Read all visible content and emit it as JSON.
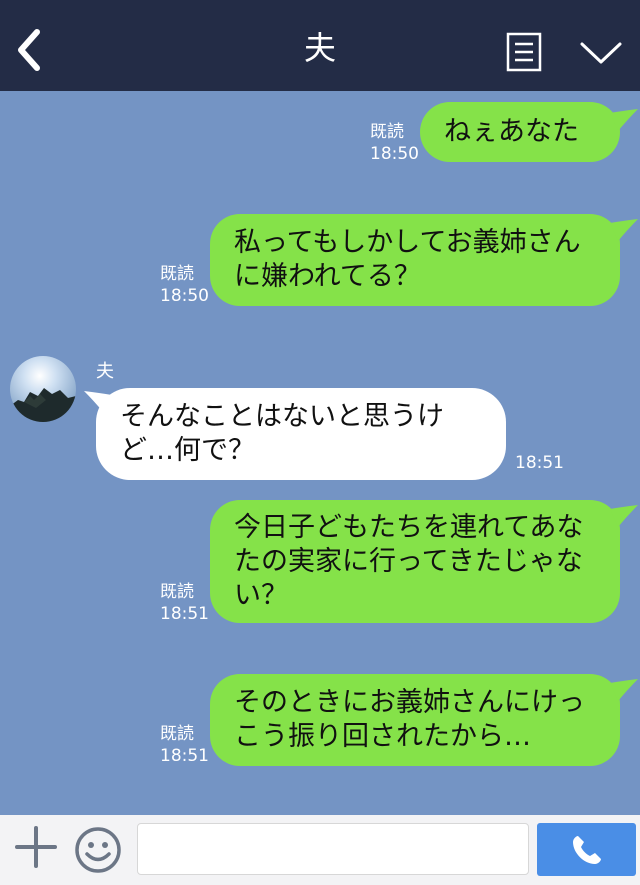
{
  "header": {
    "title": "夫",
    "back_icon": "chevron-left-icon",
    "notes_icon": "notes-icon",
    "menu_icon": "chevron-down-icon"
  },
  "messages": [
    {
      "side": "me",
      "text": "ねぇあなた",
      "read": "既読",
      "time": "18:50"
    },
    {
      "side": "me",
      "text": "私ってもしかしてお義姉さんに嫌われてる？",
      "read": "既読",
      "time": "18:50"
    },
    {
      "side": "other",
      "sender": "夫",
      "text": "そんなことはないと思うけど…何で？",
      "time": "18:51"
    },
    {
      "side": "me",
      "text": "今日子どもたちを連れてあなたの実家に行ってきたじゃない？",
      "read": "既読",
      "time": "18:51"
    },
    {
      "side": "me",
      "text": "そのときにお義姉さんにけっこう振り回されたから…",
      "read": "既読",
      "time": "18:51"
    }
  ],
  "footer": {
    "plus_icon": "plus-icon",
    "emoji_icon": "smiley-icon",
    "input_value": "",
    "call_icon": "phone-icon"
  },
  "colors": {
    "header": "#232c46",
    "chat_bg": "#7494c4",
    "my_bubble": "#85e249",
    "their_bubble": "#ffffff",
    "call_button": "#4a8ee6"
  }
}
